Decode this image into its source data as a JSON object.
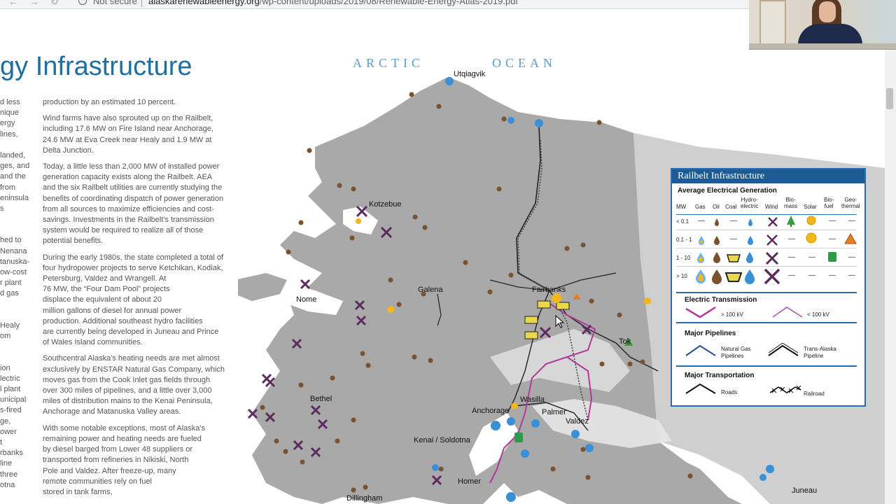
{
  "browser": {
    "not_secure": "Not secure",
    "url_domain": "alaskarenewableenergy.org",
    "url_path": "/wp-content/uploads/2019/08/Renewable-Energy-Atlas-2019.pdf"
  },
  "page": {
    "heading": "gy Infrastructure",
    "left_col": [
      "d less",
      "nique",
      "ergy",
      " lines,",
      "",
      "landed,",
      "ges, and",
      "and the",
      " from",
      "eninsula",
      "s",
      "",
      "",
      "hed to",
      " Nenana",
      "tanuska-",
      "ow-cost",
      "r plant",
      "d gas",
      "",
      "",
      "Healy",
      "om",
      "",
      "",
      "ion",
      "lectric",
      "l plant",
      "unicipal",
      "s-fired",
      "ge,",
      "ower",
      "t",
      "rbanks",
      "line",
      " three",
      "otna"
    ],
    "mid_paras": [
      [
        "production by an estimated 10 percent."
      ],
      [
        "Wind farms have also sprouted up on the Railbelt,",
        "including 17.6 MW on Fire Island near Anchorage,",
        "24.6 MW at Eva Creek near Healy and 1.9 MW at",
        "Delta Junction."
      ],
      [
        "Today, a little less than 2,000 MW of installed power",
        "generation capacity exists along the Railbelt. AEA",
        "and the six Railbelt utilities are currently studying the",
        "benefits of coordinating dispatch of power generation",
        "from all sources to maximize efficiencies and cost-",
        "savings. Investments in the Railbelt's transmission",
        "system would be required to realize all of those",
        "potential benefits."
      ],
      [
        "During the early 1980s, the state completed a total of",
        "four hydropower projects to serve Ketchikan, Kodiak,",
        "Petersburg, Valdez and Wrangell. At",
        "76 MW, the “Four Dam Pool” projects",
        "displace the equivalent of about 20",
        "million gallons of diesel for annual power",
        "production. Additional southeast hydro facilities",
        "are currently being developed in Juneau and Prince",
        "of Wales Island communities."
      ],
      [
        "Southcentral Alaska's heating needs are met almost",
        "exclusively by ENSTAR Natural Gas Company, which",
        "moves gas from the Cook Inlet gas fields through",
        "over 300 miles of pipelines, and a little over 3,000",
        "miles of distribution mains to the Kenai Peninsula,",
        "Anchorage and Matanuska Valley areas."
      ],
      [
        "With some notable exceptions, most of Alaska's",
        "remaining power and heating needs are fueled",
        "by diesel barged from Lower 48 suppliers or",
        "transported from refineries in Nikiski, North",
        "Pole and Valdez. After freeze-up, many",
        "remote communities rely on fuel",
        "stored in tank farms,"
      ]
    ]
  },
  "map": {
    "ocean_label_1": "ARCTIC",
    "ocean_label_2": "OCEAN",
    "places": {
      "utqiagvik": "Utqiagvik",
      "kotzebue": "Kotzebue",
      "nome": "Nome",
      "galena": "Galena",
      "fairbanks": "Fairbanks",
      "tok": "Tok",
      "bethel": "Bethel",
      "wasilla": "Wasilla",
      "palmer": "Palmer",
      "anchorage": "Anchorage",
      "valdez": "Valdez",
      "kenai": "Kenai / Soldotna",
      "homer": "Homer",
      "dillingham": "Dillingham",
      "juneau": "Juneau"
    },
    "colors": {
      "land": "#a9a9a9",
      "water": "#ffffff",
      "oil": "#7a5230",
      "hydro": "#3b8fd6",
      "wind": "#5b2a5e",
      "coal": "#e8d84a",
      "solar": "#f2b718",
      "transmission": "#b03a9a"
    }
  },
  "legend": {
    "title": "Railbelt Infrastructure",
    "avg_gen_title": "Average Electrical Generation",
    "columns": {
      "mw": "MW",
      "gas": "Gas",
      "oil": "Oil",
      "coal": "Coal",
      "hydro_1": "Hydro-",
      "hydro_2": "electric",
      "wind": "Wind",
      "bio_1": "Bio-",
      "bio_2": "mass",
      "solar": "Solar",
      "biofuel_1": "Bio-",
      "biofuel_2": "fuel",
      "geo_1": "Geo-",
      "geo_2": "thermal"
    },
    "rows": {
      "r1": "< 0.1",
      "r2": "0.1 - 1",
      "r3": "1 - 10",
      "r4": "> 10"
    },
    "dash": "—",
    "electric_transmission_title": "Electric Transmission",
    "over_100kv": "> 100 kV",
    "under_100kv": "< 100 kV",
    "pipelines_title": "Major Pipelines",
    "natural_gas_1": "Natural Gas",
    "natural_gas_2": "Pipelines",
    "trans_alaska_1": "Trans-Alaska",
    "trans_alaska_2": "Pipeline",
    "transportation_title": "Major Transportation",
    "roads": "Roads",
    "railroad": "Railroad"
  }
}
